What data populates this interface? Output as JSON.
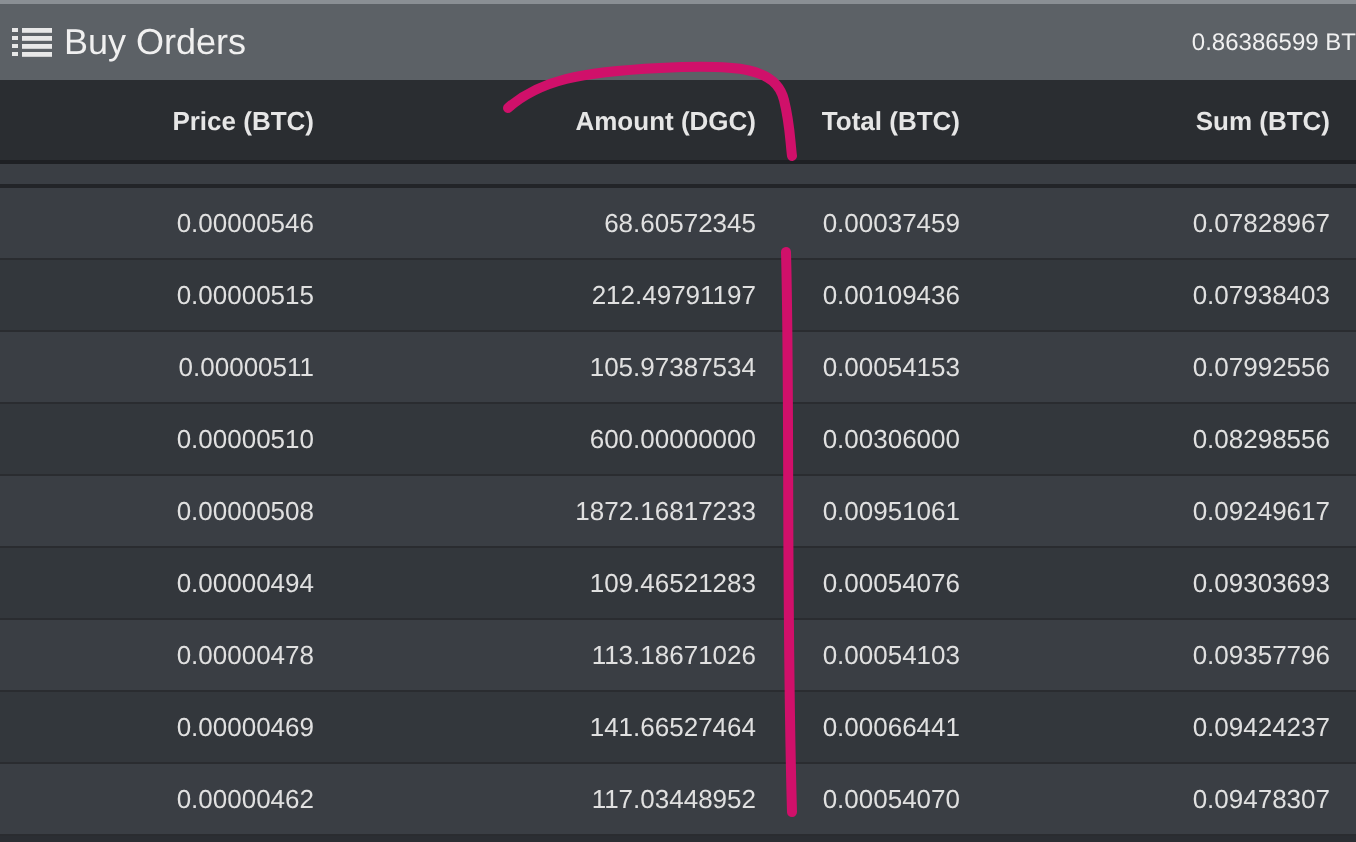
{
  "panel": {
    "title": "Buy Orders",
    "total": "0.86386599 BT"
  },
  "table": {
    "columns": [
      "Price (BTC)",
      "Amount (DGC)",
      "Total (BTC)",
      "Sum (BTC)"
    ],
    "rows": [
      [
        "0.00000546",
        "68.60572345",
        "0.00037459",
        "0.07828967"
      ],
      [
        "0.00000515",
        "212.49791197",
        "0.00109436",
        "0.07938403"
      ],
      [
        "0.00000511",
        "105.97387534",
        "0.00054153",
        "0.07992556"
      ],
      [
        "0.00000510",
        "600.00000000",
        "0.00306000",
        "0.08298556"
      ],
      [
        "0.00000508",
        "1872.16817233",
        "0.00951061",
        "0.09249617"
      ],
      [
        "0.00000494",
        "109.46521283",
        "0.00054076",
        "0.09303693"
      ],
      [
        "0.00000478",
        "113.18671026",
        "0.00054103",
        "0.09357796"
      ],
      [
        "0.00000469",
        "141.66527464",
        "0.00066441",
        "0.09424237"
      ],
      [
        "0.00000462",
        "117.03448952",
        "0.00054070",
        "0.09478307"
      ]
    ]
  }
}
